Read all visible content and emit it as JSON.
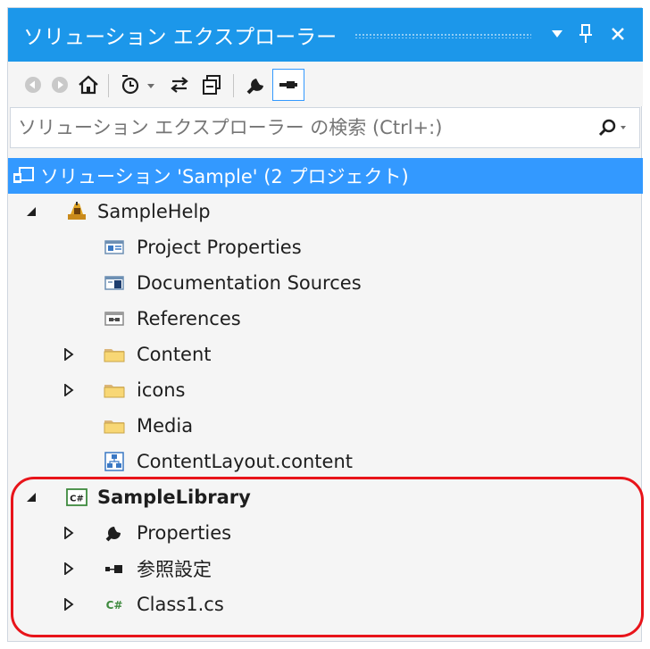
{
  "window": {
    "title": "ソリューション エクスプローラー",
    "colors": {
      "title_bar": "#1c97ea",
      "selected_row": "#3399ff",
      "highlight_box": "#e8141a"
    }
  },
  "title_buttons": [
    {
      "name": "dropdown-arrow-icon",
      "glyph": "▼"
    },
    {
      "name": "pin-icon",
      "glyph": "⊥"
    },
    {
      "name": "close-icon",
      "glyph": "✕"
    }
  ],
  "toolbar": {
    "items": [
      "back-icon",
      "forward-icon",
      "home-icon",
      "pending-changes-filter-icon",
      "sync-with-active-document-icon",
      "collapse-all-icon",
      "properties-icon",
      "preview-selected-items-icon"
    ]
  },
  "search": {
    "placeholder": "ソリューション エクスプローラー の検索 (Ctrl+:)",
    "icon": "search-icon"
  },
  "tree": {
    "solution": {
      "label": "ソリューション 'Sample' (2 プロジェクト)",
      "icon": "solution-icon",
      "selected": true
    },
    "project1": {
      "label": "SampleHelp",
      "icon": "help-project-icon",
      "expanded": true,
      "children": [
        {
          "label": "Project Properties",
          "icon": "project-properties-icon",
          "expandable": false
        },
        {
          "label": "Documentation Sources",
          "icon": "documentation-sources-icon",
          "expandable": false
        },
        {
          "label": "References",
          "icon": "references-icon",
          "expandable": false
        },
        {
          "label": "Content",
          "icon": "folder-icon",
          "expandable": true
        },
        {
          "label": "icons",
          "icon": "folder-icon",
          "expandable": true
        },
        {
          "label": "Media",
          "icon": "folder-icon",
          "expandable": false
        },
        {
          "label": "ContentLayout.content",
          "icon": "content-layout-icon",
          "expandable": false
        }
      ]
    },
    "project2": {
      "label": "SampleLibrary",
      "icon": "csharp-project-icon",
      "expanded": true,
      "bold": true,
      "children": [
        {
          "label": "Properties",
          "icon": "wrench-icon",
          "expandable": true
        },
        {
          "label": "参照設定",
          "icon": "references-icon",
          "expandable": true
        },
        {
          "label": "Class1.cs",
          "icon": "csharp-file-icon",
          "expandable": true
        }
      ]
    }
  }
}
